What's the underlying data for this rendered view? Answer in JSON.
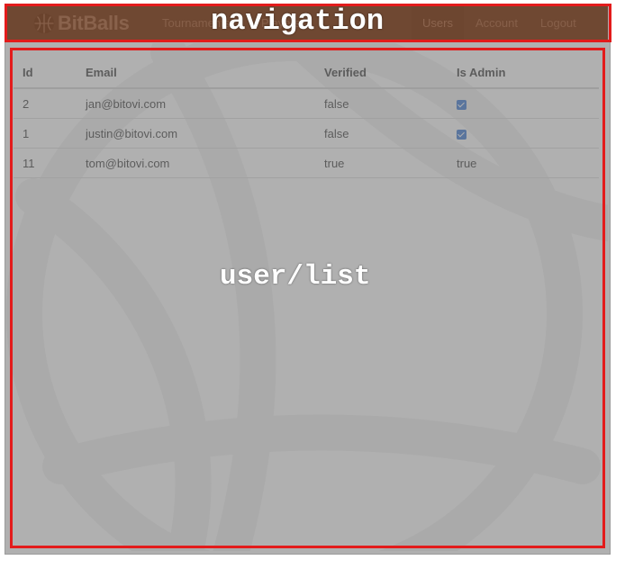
{
  "brand": {
    "name": "BitBalls",
    "icon": "basketball-icon"
  },
  "nav": {
    "links": [
      {
        "label": "Tournaments",
        "active": false
      },
      {
        "label": "Players",
        "active": false
      },
      {
        "label": "Users",
        "active": true
      },
      {
        "label": "Account",
        "active": false
      },
      {
        "label": "Logout",
        "active": false
      }
    ]
  },
  "users_table": {
    "headers": [
      "Id",
      "Email",
      "Verified",
      "Is Admin"
    ],
    "rows": [
      {
        "id": "2",
        "email": "jan@bitovi.com",
        "verified": "false",
        "is_admin": true,
        "is_admin_display": "checkbox-checked"
      },
      {
        "id": "1",
        "email": "justin@bitovi.com",
        "verified": "false",
        "is_admin": true,
        "is_admin_display": "checkbox-checked"
      },
      {
        "id": "11",
        "email": "tom@bitovi.com",
        "verified": "true",
        "is_admin": "true",
        "is_admin_display": "text"
      }
    ]
  },
  "annotations": {
    "navigation_label": "navigation",
    "main_label": "user/list",
    "box_color": "#e31b1b"
  },
  "colors": {
    "navbar_bg": "#3a3a3a",
    "checkbox": "#1f65cc",
    "overlay": "rgba(128,128,128,0.62)"
  }
}
